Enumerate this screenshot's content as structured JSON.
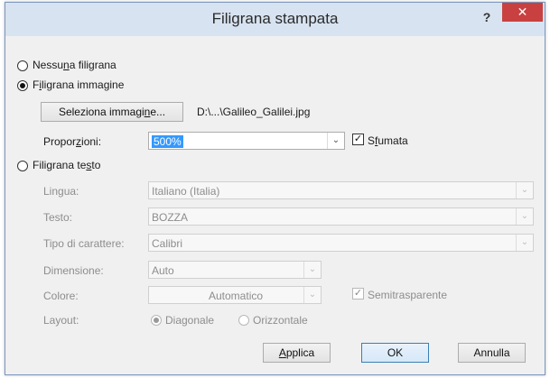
{
  "window": {
    "title": "Filigrana stampata",
    "help_icon": "?",
    "close_icon": "✕"
  },
  "options": {
    "none_label_pre": "Nessu",
    "none_label_acc": "n",
    "none_label_post": "a filigrana",
    "picture_label_pre": "F",
    "picture_label_acc": "i",
    "picture_label_post": "ligrana immagine",
    "text_label_pre": "Filigrana te",
    "text_label_acc": "s",
    "text_label_post": "to"
  },
  "picture": {
    "select_button_pre": "Seleziona immagi",
    "select_button_acc": "n",
    "select_button_post": "e...",
    "file_path": "D:\\...\\Galileo_Galilei.jpg",
    "scale_label_pre": "Propor",
    "scale_label_acc": "z",
    "scale_label_post": "ioni:",
    "scale_value": "500%",
    "washout_label_pre": "S",
    "washout_label_acc": "f",
    "washout_label_post": "umata"
  },
  "text_options": {
    "language_label": "Lingua:",
    "language_value": "Italiano (Italia)",
    "text_label": "Testo:",
    "text_value": "BOZZA",
    "font_label": "Tipo di carattere:",
    "font_value": "Calibri",
    "size_label": "Dimensione:",
    "size_value": "Auto",
    "color_label": "Colore:",
    "color_value": "Automatico",
    "semitransparent_label": "Semitrasparente",
    "layout_label": "Layout:",
    "diagonal_label": "Diagonale",
    "horizontal_label": "Orizzontale"
  },
  "buttons": {
    "apply_pre": "",
    "apply_acc": "A",
    "apply_post": "pplica",
    "ok": "OK",
    "cancel": "Annulla"
  }
}
